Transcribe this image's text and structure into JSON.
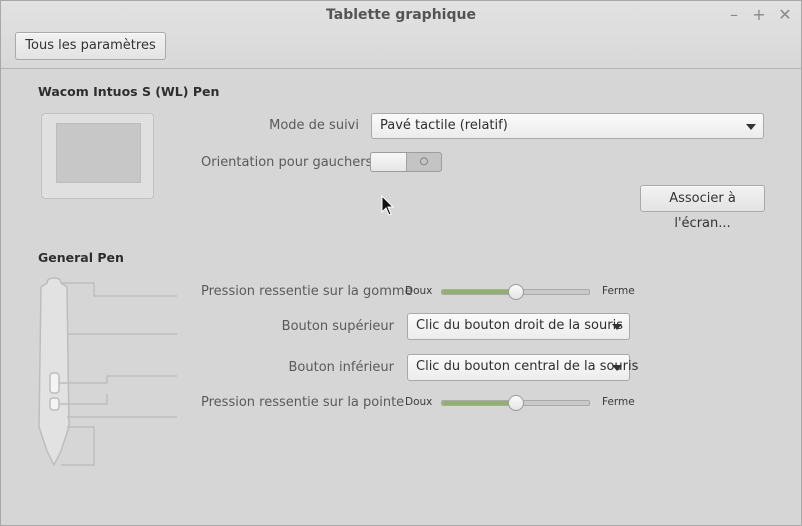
{
  "window": {
    "title": "Tablette graphique",
    "controls": [
      "–",
      "+",
      "✕"
    ]
  },
  "toolbar": {
    "all_settings": "Tous les paramètres"
  },
  "tablet": {
    "name": "Wacom Intuos S (WL) Pen",
    "tracking_mode_label": "Mode de suivi",
    "tracking_mode_value": "Pavé tactile (relatif)",
    "left_handed_label": "Orientation pour gauchers",
    "left_handed_state": "○",
    "map_button": "Associer à l'écran..."
  },
  "pen": {
    "name": "General Pen",
    "eraser_pressure_label": "Pression ressentie sur la gomme",
    "eraser_pressure_value": 0.5,
    "upper_button_label": "Bouton supérieur",
    "upper_button_value": "Clic du bouton droit de la souris",
    "lower_button_label": "Bouton inférieur",
    "lower_button_value": "Clic du bouton central de la souris",
    "tip_pressure_label": "Pression ressentie sur la pointe",
    "tip_pressure_value": 0.5,
    "soft": "Doux",
    "firm": "Ferme"
  },
  "colors": {
    "accent": "#8cb368",
    "background": "#d6d6d6"
  }
}
